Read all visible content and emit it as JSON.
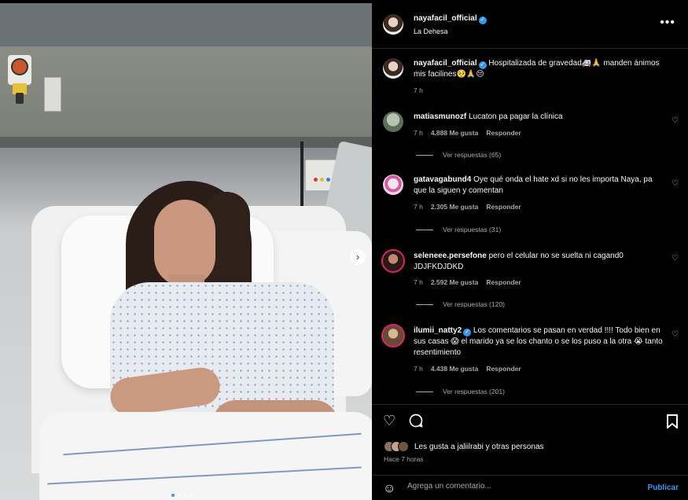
{
  "post": {
    "author": "nayafacil_official",
    "location": "La Dehesa",
    "caption_text": "Hospitalizada de gravedad🚑🙏 manden ánimos mis facilines🥺🙏😔",
    "caption_time": "7 h"
  },
  "comments": [
    {
      "user": "matiasmunozf",
      "text": "Lucaton pa pagar la clínica",
      "time": "7 h",
      "likes": "4.888 Me gusta",
      "reply": "Responder",
      "view_replies": "Ver respuestas (65)",
      "verified": false
    },
    {
      "user": "gatavagabund4",
      "text": "Oye qué onda el hate xd si no les importa Naya, pa que la siguen y comentan",
      "time": "7 h",
      "likes": "2.305 Me gusta",
      "reply": "Responder",
      "view_replies": "Ver respuestas (31)",
      "verified": false
    },
    {
      "user": "seleneee.persefone",
      "text": "pero el celular no se suelta ni cagand0 JDJFKDJDKD",
      "time": "7 h",
      "likes": "2.592 Me gusta",
      "reply": "Responder",
      "view_replies": "Ver respuestas (120)",
      "verified": false
    },
    {
      "user": "ilumii_natty2",
      "text": "Los comentarios se pasan en verdad !!!! Todo bien en sus casas 😱 el marido ya se los chanto o se los puso a la otra 😭 tanto resentimiento",
      "time": "7 h",
      "likes": "4.438 Me gusta",
      "reply": "Responder",
      "view_replies": "Ver respuestas (201)",
      "verified": true
    }
  ],
  "footer": {
    "likes_text": "Les gusta a jaliilrabi y otras personas",
    "time_ago": "Hace 7 horas",
    "comment_placeholder": "Agrega un comentario...",
    "publish_label": "Publicar"
  },
  "icons": {
    "more": "more-options-icon",
    "like": "heart-icon",
    "comment": "comment-icon",
    "save": "bookmark-icon",
    "emoji": "emoji-icon",
    "next": "chevron-right-icon"
  },
  "colors": {
    "background": "#000000",
    "text": "#f5f5f5",
    "secondary_text": "#a8a8a8",
    "accent": "#3797f0",
    "divider": "#262626"
  },
  "carousel": {
    "slides": 4,
    "active": 1
  }
}
